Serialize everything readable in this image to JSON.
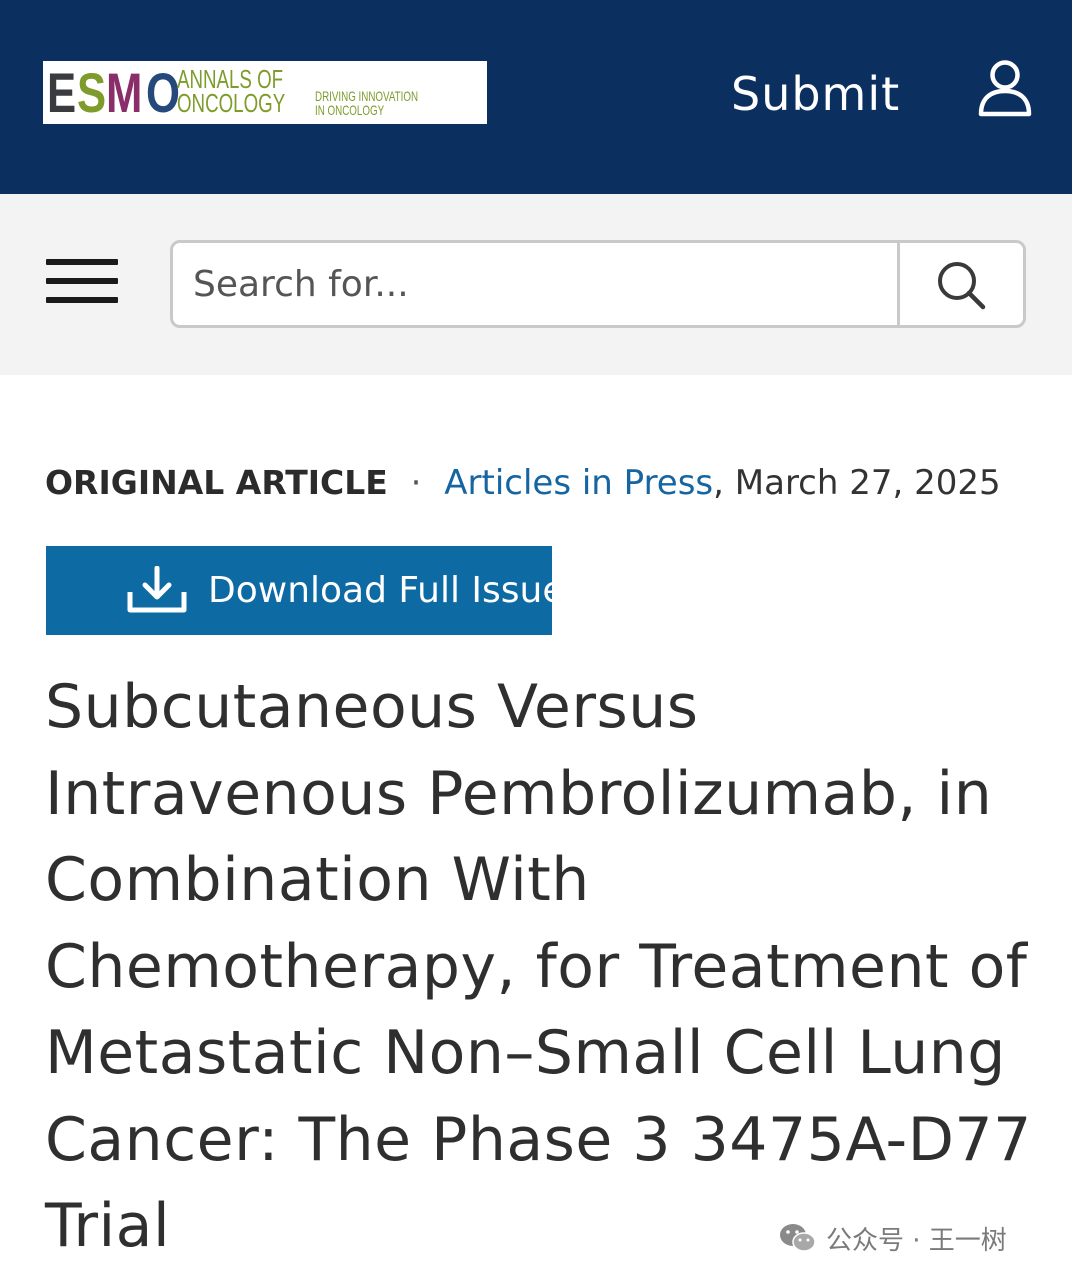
{
  "header": {
    "logo": {
      "letters": [
        "E",
        "S",
        "M",
        "O"
      ],
      "journal_name": "ANNALS OF ONCOLOGY",
      "tagline": "DRIVING INNOVATION IN ONCOLOGY",
      "colors": {
        "e": "#3a3b3f",
        "s": "#7e9c2c",
        "m": "#8a2e6a",
        "o": "#26497c",
        "text": "#7e9c2c"
      }
    },
    "submit_label": "Submit",
    "user_icon": "user-icon",
    "background": "#0b2f5f"
  },
  "search": {
    "menu_icon": "hamburger-menu-icon",
    "placeholder": "Search for...",
    "search_icon": "search-icon"
  },
  "article": {
    "type": "ORIGINAL ARTICLE",
    "separator": "·",
    "section_link": "Articles in Press",
    "date": ", March 27, 2025",
    "download_label": "Download Full Issue",
    "download_icon": "download-icon",
    "title_lines": [
      "Subcutaneous Versus",
      "Intravenous Pembrolizumab, in",
      "Combination With",
      "Chemotherapy, for Treatment of",
      "Metastatic Non–Small Cell Lung",
      "Cancer: The Phase 3 3475A-D77",
      "Trial"
    ]
  },
  "watermark": {
    "icon": "wechat-icon",
    "text": "公众号 · 王一树"
  },
  "colors": {
    "accent_blue": "#0d6aa3",
    "link_blue": "#1565a3"
  }
}
